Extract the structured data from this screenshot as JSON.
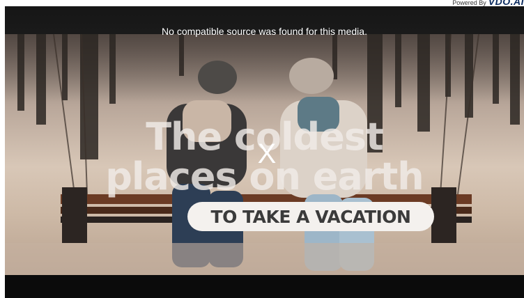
{
  "powered_by": {
    "prefix": "Powered By",
    "brand": "VDO.AI"
  },
  "player": {
    "error_message": "No compatible source was found for this media.",
    "close_label": "X"
  },
  "video_frame": {
    "headline_line1": "The coldest",
    "headline_line2": "places on earth",
    "subtitle": "TO TAKE A VACATION"
  }
}
